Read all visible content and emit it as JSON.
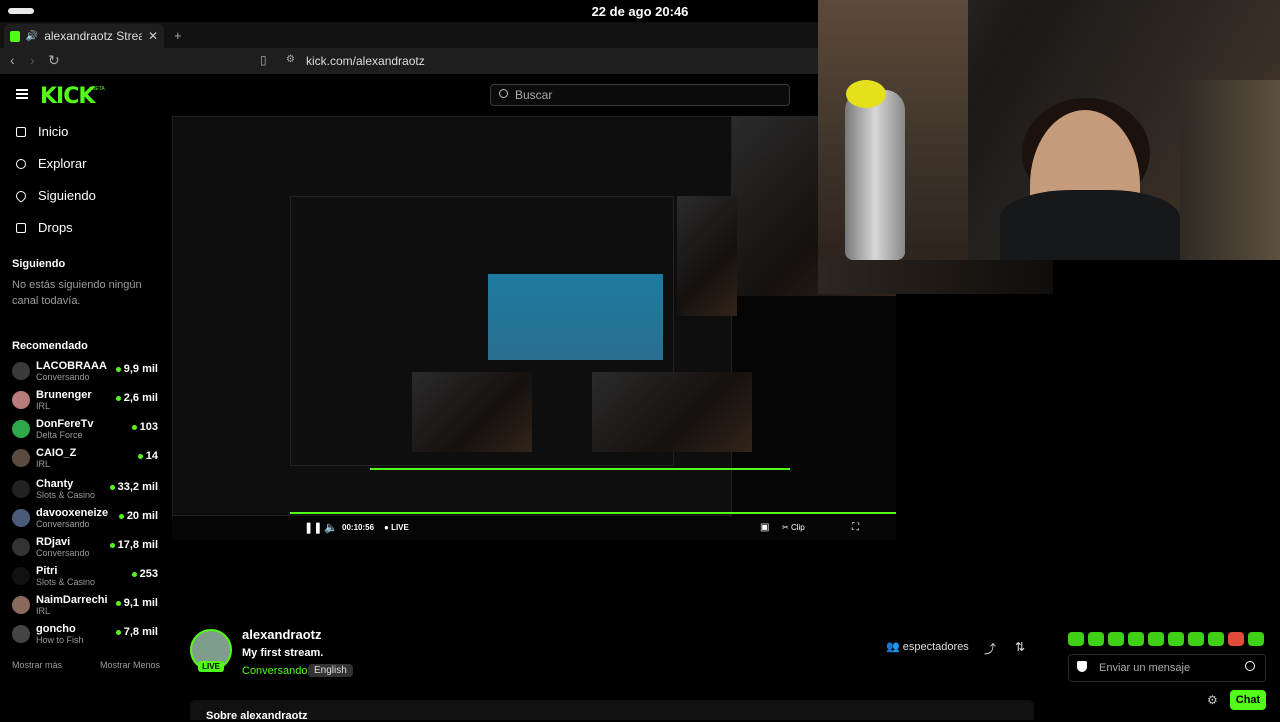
{
  "os": {
    "clock": "22 de ago  20:46"
  },
  "browser": {
    "tab_title": "alexandraotz Stream",
    "url": "kick.com/alexandraotz"
  },
  "site": {
    "logo": "KICK",
    "beta": "BETA",
    "search_placeholder": "Buscar"
  },
  "sidebar": {
    "nav": [
      {
        "label": "Inicio",
        "icon": "home-icon"
      },
      {
        "label": "Explorar",
        "icon": "compass-icon"
      },
      {
        "label": "Siguiendo",
        "icon": "heart-icon"
      },
      {
        "label": "Drops",
        "icon": "gift-icon"
      }
    ],
    "following_title": "Siguiendo",
    "following_empty": "No estás siguiendo ningún canal todavía.",
    "recommended_title": "Recomendado",
    "recommended": [
      {
        "name": "LACOBRAAA",
        "category": "Conversando",
        "viewers": "9,9 mil"
      },
      {
        "name": "Brunenger",
        "category": "IRL",
        "viewers": "2,6 mil"
      },
      {
        "name": "DonFereTv",
        "category": "Delta Force",
        "viewers": "103"
      },
      {
        "name": "CAIO_Z",
        "category": "IRL",
        "viewers": "14"
      },
      {
        "name": "Chanty",
        "category": "Slots & Casino",
        "viewers": "33,2 mil"
      },
      {
        "name": "davooxeneize",
        "category": "Conversando",
        "viewers": "20 mil"
      },
      {
        "name": "RDjavi",
        "category": "Conversando",
        "viewers": "17,8 mil"
      },
      {
        "name": "Pitri",
        "category": "Slots & Casino",
        "viewers": "253"
      },
      {
        "name": "NaimDarrechi",
        "category": "IRL",
        "viewers": "9,1 mil"
      },
      {
        "name": "goncho",
        "category": "How to Fish",
        "viewers": "7,8 mil"
      }
    ],
    "show_more": "Mostrar más",
    "show_less": "Mostrar Menos"
  },
  "player": {
    "time": "00:10:56",
    "live": "LIVE",
    "clip": "Clip"
  },
  "channel": {
    "name": "alexandraotz",
    "title": "My first stream.",
    "category": "Conversando",
    "language": "English",
    "live_tag": "LIVE",
    "viewers_label": "espectadores",
    "about": "Sobre alexandraotz"
  },
  "chat": {
    "placeholder": "Enviar un mensaje",
    "button": "Chat"
  },
  "colors": {
    "accent": "#53fc18",
    "bg": "#000000"
  }
}
